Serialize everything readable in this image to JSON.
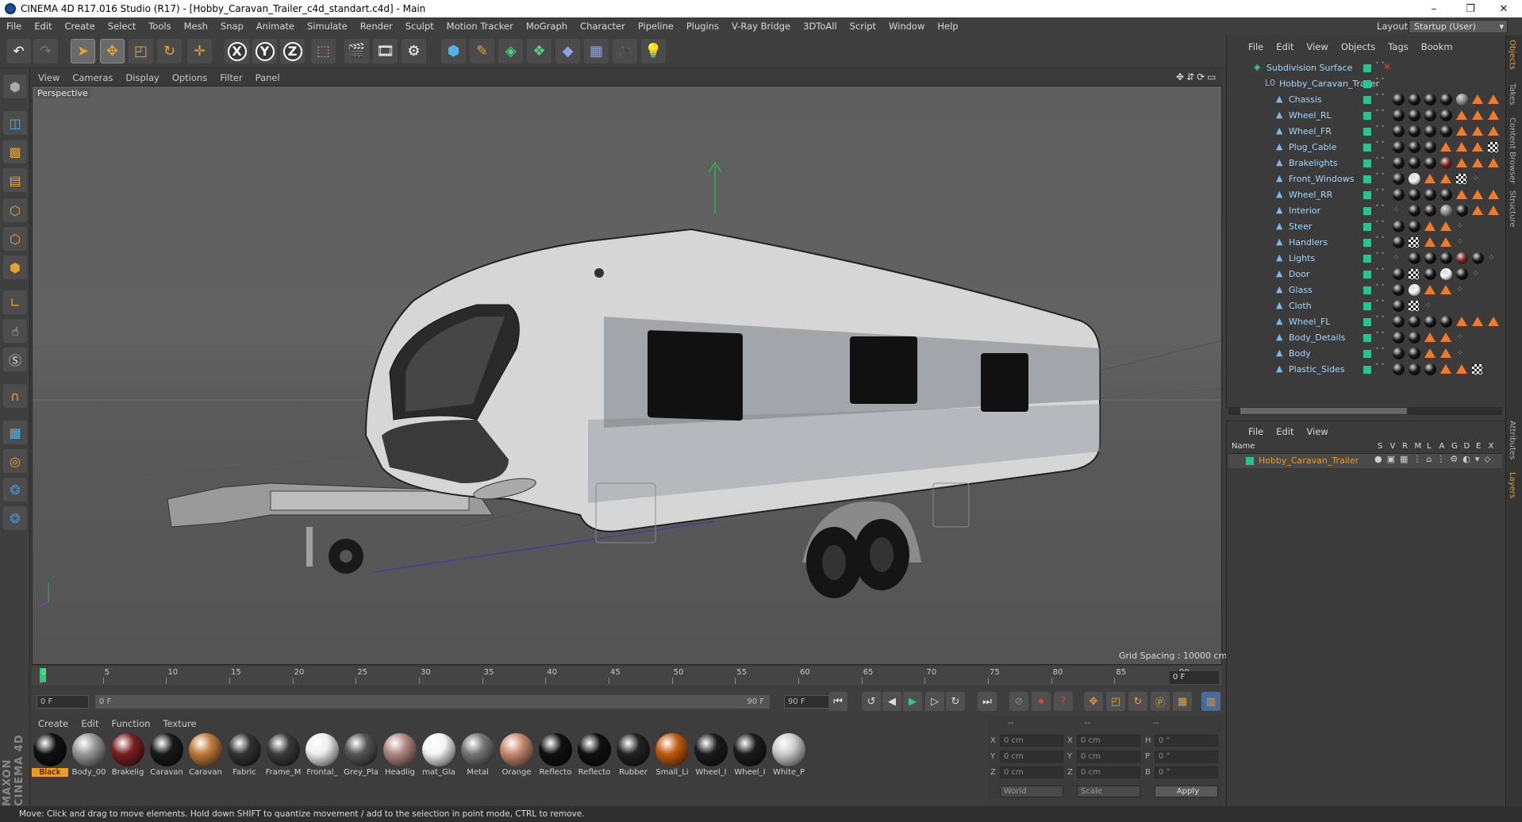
{
  "window": {
    "title": "CINEMA 4D R17.016 Studio (R17) - [Hobby_Caravan_Trailer_c4d_standart.c4d] - Main",
    "controls": [
      "–",
      "❐",
      "✕"
    ]
  },
  "menubar": [
    "File",
    "Edit",
    "Create",
    "Select",
    "Tools",
    "Mesh",
    "Snap",
    "Animate",
    "Simulate",
    "Render",
    "Sculpt",
    "Motion Tracker",
    "MoGraph",
    "Character",
    "Pipeline",
    "Plugins",
    "V-Ray Bridge",
    "3DToAll",
    "Script",
    "Window",
    "Help"
  ],
  "layout": {
    "label": "Layout:",
    "value": "Startup (User)"
  },
  "viewport": {
    "menu": [
      "View",
      "Cameras",
      "Display",
      "Options",
      "Filter",
      "Panel"
    ],
    "label": "Perspective",
    "grid_spacing": "Grid Spacing : 10000 cm"
  },
  "timeline": {
    "ticks": [
      "0",
      "5",
      "10",
      "15",
      "20",
      "25",
      "30",
      "35",
      "40",
      "45",
      "50",
      "55",
      "60",
      "65",
      "70",
      "75",
      "80",
      "85",
      "90"
    ],
    "current": "0 F",
    "start": "0 F",
    "range_start": "0 F",
    "range_end": "90 F",
    "end": "90 F"
  },
  "materials": {
    "menu": [
      "Create",
      "Edit",
      "Function",
      "Texture"
    ],
    "items": [
      {
        "name": "Black",
        "color": "#111"
      },
      {
        "name": "Body_00",
        "color": "#999"
      },
      {
        "name": "Brakelig",
        "color": "#7a2020"
      },
      {
        "name": "Caravan",
        "color": "#1a1a1a"
      },
      {
        "name": "Caravan",
        "color": "#c07a3a"
      },
      {
        "name": "Fabric",
        "color": "#333"
      },
      {
        "name": "Frame_M",
        "color": "#3a3a3a"
      },
      {
        "name": "Frontal_",
        "color": "#eee"
      },
      {
        "name": "Grey_Pla",
        "color": "#555"
      },
      {
        "name": "Headlig",
        "color": "#b08880"
      },
      {
        "name": "mat_Gla",
        "color": "#f4f4f4"
      },
      {
        "name": "Metal",
        "color": "#777"
      },
      {
        "name": "Orange",
        "color": "#c88a70"
      },
      {
        "name": "Reflecto",
        "color": "#111"
      },
      {
        "name": "Reflecto",
        "color": "#111"
      },
      {
        "name": "Rubber",
        "color": "#222"
      },
      {
        "name": "Small_Li",
        "color": "#c05a10"
      },
      {
        "name": "Wheel_I",
        "color": "#1c1c1c"
      },
      {
        "name": "Wheel_I",
        "color": "#1c1c1c"
      },
      {
        "name": "White_P",
        "color": "#ccc"
      }
    ]
  },
  "coords": {
    "headers": [
      "--",
      "--",
      "--"
    ],
    "rows": [
      {
        "a": "X",
        "av": "0 cm",
        "b": "X",
        "bv": "0 cm",
        "c": "H",
        "cv": "0 °"
      },
      {
        "a": "Y",
        "av": "0 cm",
        "b": "Y",
        "bv": "0 cm",
        "c": "P",
        "cv": "0 °"
      },
      {
        "a": "Z",
        "av": "0 cm",
        "b": "Z",
        "bv": "0 cm",
        "c": "B",
        "cv": "0 °"
      }
    ],
    "mode1": "World",
    "mode2": "Scale",
    "apply": "Apply"
  },
  "status": "Move: Click and drag to move elements. Hold down SHIFT to quantize movement / add to the selection in point mode, CTRL to remove.",
  "objects": {
    "menu": [
      "File",
      "Edit",
      "View",
      "Objects",
      "Tags",
      "Bookm"
    ],
    "items": [
      {
        "name": "Subdivision Surface",
        "indent": 0
      },
      {
        "name": "Hobby_Caravan_Trailer",
        "indent": 1
      },
      {
        "name": "Chassis",
        "indent": 2
      },
      {
        "name": "Wheel_RL",
        "indent": 2
      },
      {
        "name": "Wheel_FR",
        "indent": 2
      },
      {
        "name": "Plug_Cable",
        "indent": 2
      },
      {
        "name": "Brakelights",
        "indent": 2
      },
      {
        "name": "Front_Windows",
        "indent": 2
      },
      {
        "name": "Wheel_RR",
        "indent": 2
      },
      {
        "name": "Interior",
        "indent": 2
      },
      {
        "name": "Steer",
        "indent": 2
      },
      {
        "name": "Handlers",
        "indent": 2
      },
      {
        "name": "Lights",
        "indent": 2
      },
      {
        "name": "Door",
        "indent": 2
      },
      {
        "name": "Glass",
        "indent": 2
      },
      {
        "name": "Cloth",
        "indent": 2
      },
      {
        "name": "Wheel_FL",
        "indent": 2
      },
      {
        "name": "Body_Details",
        "indent": 2
      },
      {
        "name": "Body",
        "indent": 2
      },
      {
        "name": "Plastic_Sides",
        "indent": 2
      }
    ]
  },
  "layers": {
    "menu": [
      "File",
      "Edit",
      "View"
    ],
    "columns": [
      "Name",
      "S",
      "V",
      "R",
      "M",
      "L",
      "A",
      "G",
      "D",
      "E",
      "X"
    ],
    "row": "Hobby_Caravan_Trailer"
  },
  "right_tabs": [
    "Objects",
    "Takes",
    "Content Browser",
    "Structure",
    "Attributes",
    "Layers"
  ]
}
